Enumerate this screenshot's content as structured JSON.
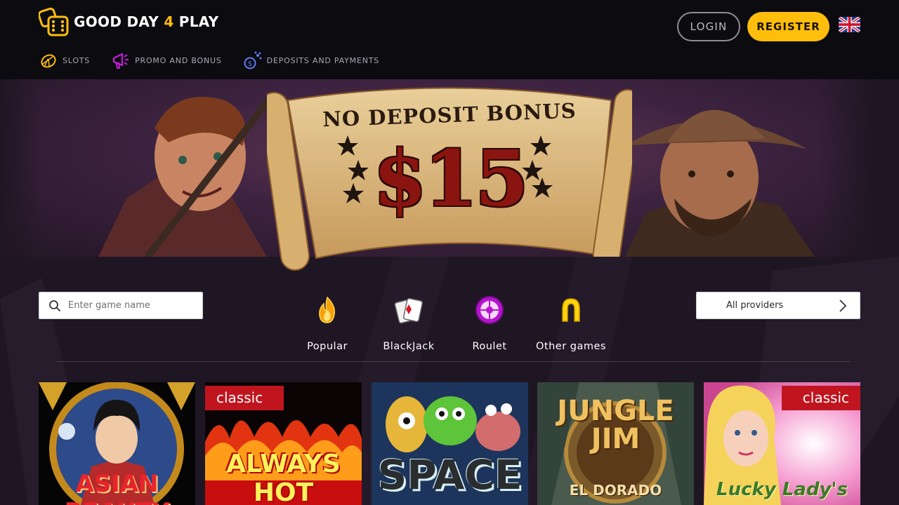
{
  "header": {
    "logo_text_left": "GOOD DAY",
    "logo_text_num": "4",
    "logo_text_right": "PLAY",
    "login_label": "LOGIN",
    "register_label": "REGISTER",
    "language_icon": "uk-flag-icon"
  },
  "nav": {
    "items": [
      {
        "label": "SLOTS",
        "icon": "lemon-icon"
      },
      {
        "label": "PROMO AND BONUS",
        "icon": "megaphone-icon"
      },
      {
        "label": "DEPOSITS AND PAYMENTS",
        "icon": "coins-icon"
      }
    ]
  },
  "hero": {
    "title": "NO DEPOSIT BONUS",
    "amount": "$15"
  },
  "search": {
    "placeholder": "Enter game name",
    "icon": "search-icon"
  },
  "categories": [
    {
      "label": "Popular",
      "icon": "flame-icon"
    },
    {
      "label": "BlackJack",
      "icon": "cards-icon"
    },
    {
      "label": "Roulet",
      "icon": "roulette-icon"
    },
    {
      "label": "Other games",
      "icon": "horseshoe-icon"
    }
  ],
  "providers": {
    "label": "All providers",
    "icon": "chevron-right-icon"
  },
  "games": [
    {
      "title": "ASIAN BEAUTY",
      "badge": ""
    },
    {
      "title": "ALWAYS HOT",
      "badge": "classic"
    },
    {
      "title": "SPACE",
      "badge": ""
    },
    {
      "title_line1": "JUNGLE",
      "title_line2": "JIM",
      "subtitle": "EL DORADO",
      "badge": ""
    },
    {
      "title": "Lucky Lady's",
      "badge": "classic"
    }
  ],
  "colors": {
    "accent": "#ffbe0b",
    "header_bg": "#0b0b10",
    "page_bg": "#1f1624",
    "classic_badge": "#c0141e"
  }
}
